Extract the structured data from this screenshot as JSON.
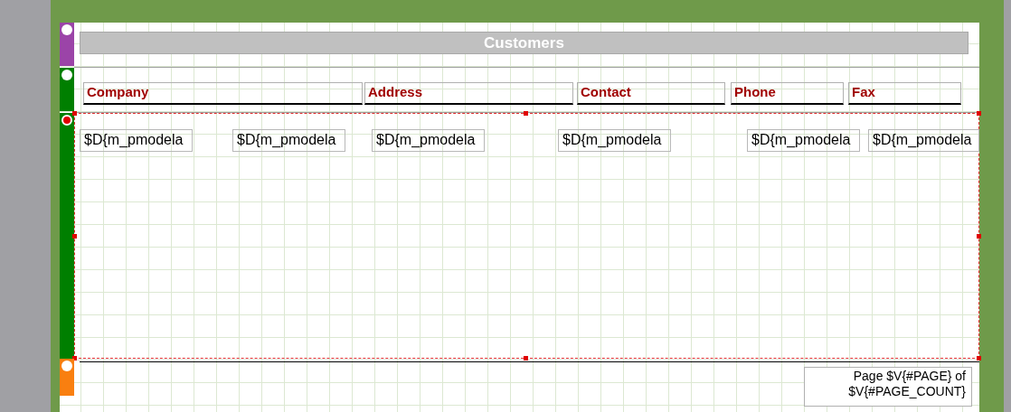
{
  "bands": [
    {
      "kind": "title",
      "color": "#9b44a8",
      "selected": false,
      "elements": [
        {
          "kind": "title_bar",
          "text": "Customers"
        }
      ]
    },
    {
      "kind": "column_header",
      "color": "#007f00",
      "selected": false,
      "elements": [
        {
          "kind": "header",
          "text": "Company"
        },
        {
          "kind": "header",
          "text": "Address"
        },
        {
          "kind": "header",
          "text": "Contact"
        },
        {
          "kind": "header",
          "text": "Phone"
        },
        {
          "kind": "header",
          "text": "Fax"
        }
      ]
    },
    {
      "kind": "detail",
      "color": "#007f00",
      "selected": true,
      "elements": [
        {
          "kind": "field",
          "text": "$D{m_pmodela"
        },
        {
          "kind": "field",
          "text": "$D{m_pmodela"
        },
        {
          "kind": "field",
          "text": "$D{m_pmodela"
        },
        {
          "kind": "field",
          "text": "$D{m_pmodela"
        },
        {
          "kind": "field",
          "text": "$D{m_pmodela"
        },
        {
          "kind": "field",
          "text": "$D{m_pmodela"
        }
      ]
    },
    {
      "kind": "page_footer",
      "color": "#f97f10",
      "selected": false,
      "elements": [
        {
          "kind": "footer_text",
          "text": "Page $V{#PAGE} of $V{#PAGE_COUNT}"
        }
      ]
    }
  ]
}
